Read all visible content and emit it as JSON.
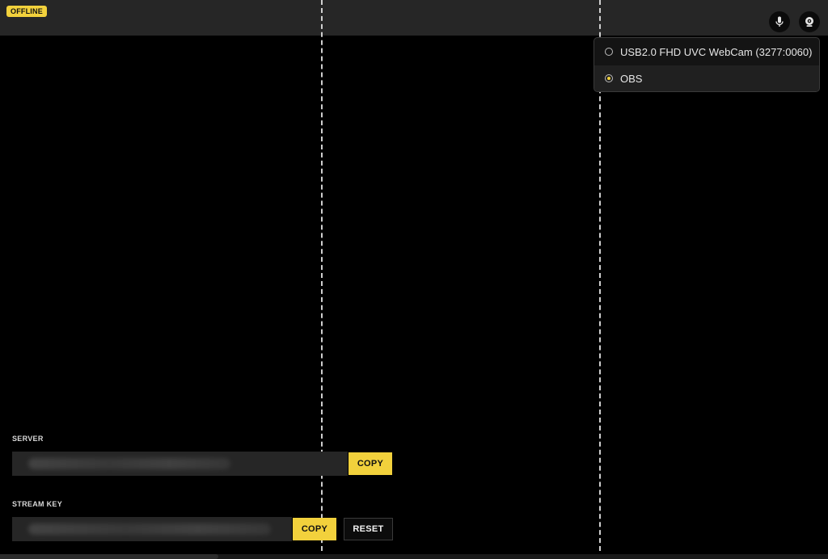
{
  "status": {
    "badge": "OFFLINE",
    "color": "#f2d13c"
  },
  "toolbar": {
    "mic_icon": "microphone-icon",
    "camera_icon": "webcam-icon"
  },
  "camera_menu": {
    "options": [
      {
        "label": "USB2.0 FHD UVC WebCam (3277:0060)",
        "selected": false
      },
      {
        "label": "OBS",
        "selected": true
      }
    ]
  },
  "server": {
    "label": "SERVER",
    "copy_label": "COPY"
  },
  "stream_key": {
    "label": "STREAM KEY",
    "copy_label": "COPY",
    "reset_label": "RESET"
  }
}
